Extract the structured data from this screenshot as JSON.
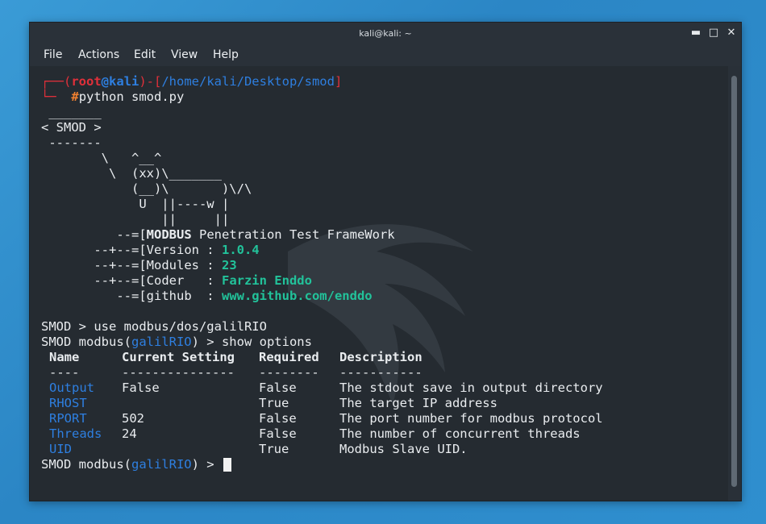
{
  "window": {
    "title": "kali@kali: ~",
    "minimize_icon": "minimize-icon",
    "maximize_icon": "maximize-icon",
    "close_icon": "close-icon",
    "min_glyph": "▬",
    "max_glyph": "□",
    "close_glyph": "✕"
  },
  "menu": {
    "file": "File",
    "actions": "Actions",
    "edit": "Edit",
    "view": "View",
    "help": "Help"
  },
  "prompt": {
    "corner_top": "┌──(",
    "user": "root",
    "at": "@",
    "host": "kali",
    "sep": ")-[",
    "path": "/home/kali/Desktop/smod",
    "close": "]",
    "corner_bottom": "└─",
    "hash": "#",
    "command": "python smod.py"
  },
  "banner": {
    "l1": " _______",
    "l2": "< SMOD >",
    "l3": " -------",
    "l4": "        \\   ^__^",
    "l5": "         \\  (xx)\\_______",
    "l6": "            (__)\\       )\\/\\",
    "l7": "             U  ||----w |",
    "l8": "                ||     ||"
  },
  "info": {
    "p1": "          --=[",
    "p2": "       --+--=[",
    "p3": "       --+--=[",
    "p4": "       --+--=[",
    "p5": "          --=[",
    "modbus": "MODBUS",
    "framework": " Penetration Test FrameWork",
    "version_label": "Version : ",
    "version": "1.0.4",
    "modules_label": "Modules : ",
    "modules": "23",
    "coder_label": "Coder   : ",
    "coder": "Farzin Enddo",
    "github_label": "github  : ",
    "github": "www.github.com/enddo"
  },
  "session": {
    "cmd1": "SMOD > use modbus/dos/galilRIO",
    "prefix": "SMOD modbus(",
    "module": "galilRIO",
    "suffix2": ") > show options",
    "suffix3": ") > "
  },
  "options": {
    "headers": [
      "Name",
      "Current Setting",
      "Required",
      "Description"
    ],
    "dashes": [
      "----",
      "---------------",
      "--------",
      "-----------"
    ],
    "rows": [
      {
        "name": "Output",
        "setting": "False",
        "required": "False",
        "desc": "The stdout save in output directory"
      },
      {
        "name": "RHOST",
        "setting": "",
        "required": "True",
        "desc": "The target IP address"
      },
      {
        "name": "RPORT",
        "setting": "502",
        "required": "False",
        "desc": "The port number for modbus protocol"
      },
      {
        "name": "Threads",
        "setting": "24",
        "required": "False",
        "desc": "The number of concurrent threads"
      },
      {
        "name": "UID",
        "setting": "",
        "required": "True",
        "desc": "Modbus Slave UID."
      }
    ]
  },
  "colors": {
    "accent_blue": "#2e7fe0",
    "prompt_red": "#e0303a",
    "teal": "#22c29a",
    "background": "#252b31"
  }
}
